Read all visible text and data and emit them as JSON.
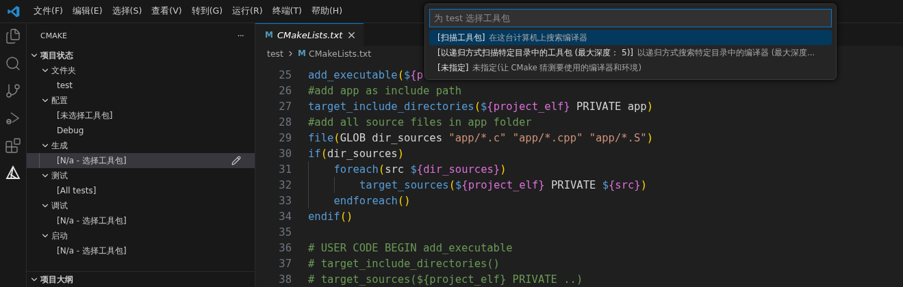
{
  "menu_bar": {
    "items": [
      "文件(F)",
      "编辑(E)",
      "选择(S)",
      "查看(V)",
      "转到(G)",
      "运行(R)",
      "终端(T)",
      "帮助(H)"
    ]
  },
  "activity_bar": [
    {
      "kind": "explorer",
      "selected": false
    },
    {
      "kind": "search",
      "selected": false
    },
    {
      "kind": "source_control",
      "selected": false
    },
    {
      "kind": "run_debug",
      "selected": false
    },
    {
      "kind": "extensions",
      "selected": false
    },
    {
      "kind": "cmake",
      "selected": true
    }
  ],
  "sidebar": {
    "title": "CMAKE",
    "more": "···",
    "sections": [
      {
        "label": "项目状态",
        "expanded": true,
        "children": [
          {
            "label": "文件夹",
            "expanded": true,
            "children": [
              {
                "label": "test",
                "selected": false
              }
            ]
          },
          {
            "label": "配置",
            "expanded": true,
            "children": [
              {
                "label": "[未选择工具包]",
                "selected": false
              },
              {
                "label": "Debug",
                "selected": false
              }
            ]
          },
          {
            "label": "生成",
            "expanded": true,
            "children": [
              {
                "label": "[N/a - 选择工具包]",
                "selected": true
              }
            ]
          },
          {
            "label": "测试",
            "expanded": true,
            "children": [
              {
                "label": "[All tests]",
                "selected": false
              }
            ]
          },
          {
            "label": "调试",
            "expanded": true,
            "children": [
              {
                "label": "[N/a - 选择工具包]",
                "selected": false
              }
            ]
          },
          {
            "label": "启动",
            "expanded": true,
            "children": [
              {
                "label": "[N/a - 选择工具包]",
                "selected": false
              }
            ]
          }
        ]
      },
      {
        "label": "项目大纲",
        "expanded": true
      }
    ]
  },
  "tabs": [
    {
      "label": "CMakeLists.txt",
      "icon": "M",
      "selected": true
    }
  ],
  "breadcrumb": [
    {
      "label": "test"
    },
    {
      "label": "CMakeLists.txt",
      "icon": "M"
    }
  ],
  "code": [
    {
      "number": "25",
      "tokens": [
        {
          "kind": "fn",
          "text": "add_executable"
        },
        {
          "kind": "paren",
          "text": "("
        },
        {
          "kind": "dollar",
          "text": "$"
        },
        {
          "kind": "var",
          "text": "{p"
        }
      ]
    },
    {
      "number": "26",
      "tokens": [
        {
          "kind": "comment",
          "text": "#add app as include path"
        }
      ]
    },
    {
      "number": "27",
      "tokens": [
        {
          "kind": "fn",
          "text": "target_include_directories"
        },
        {
          "kind": "paren",
          "text": "("
        },
        {
          "kind": "dollar",
          "text": "$"
        },
        {
          "kind": "var",
          "text": "{project_elf}"
        },
        {
          "kind": "plain",
          "text": " PRIVATE app"
        },
        {
          "kind": "paren",
          "text": ")"
        }
      ]
    },
    {
      "number": "28",
      "tokens": [
        {
          "kind": "comment",
          "text": "#add all source files in app folder"
        }
      ]
    },
    {
      "number": "29",
      "tokens": [
        {
          "kind": "fn",
          "text": "file"
        },
        {
          "kind": "paren",
          "text": "("
        },
        {
          "kind": "plain",
          "text": "GLOB dir_sources "
        },
        {
          "kind": "string",
          "text": "\"app/*.c\" "
        },
        {
          "kind": "string",
          "text": "\"app/*.cpp\" "
        },
        {
          "kind": "string",
          "text": "\"app/*.S\""
        },
        {
          "kind": "paren",
          "text": ")"
        }
      ]
    },
    {
      "number": "30",
      "tokens": [
        {
          "kind": "fn",
          "text": "if"
        },
        {
          "kind": "paren",
          "text": "("
        },
        {
          "kind": "plain",
          "text": "dir_sources"
        },
        {
          "kind": "paren",
          "text": ")"
        }
      ],
      "children": [
        {
          "number": "31",
          "tokens": [
            {
              "kind": "fn",
              "text": "foreach"
            },
            {
              "kind": "paren",
              "text": "("
            },
            {
              "kind": "plain",
              "text": "src "
            },
            {
              "kind": "dollar",
              "text": "$"
            },
            {
              "kind": "var",
              "text": "{dir_sources}"
            },
            {
              "kind": "paren",
              "text": ")"
            }
          ],
          "children": [
            {
              "number": "32",
              "tokens": [
                {
                  "kind": "fn",
                  "text": "target_sources"
                },
                {
                  "kind": "paren",
                  "text": "("
                },
                {
                  "kind": "dollar",
                  "text": "$"
                },
                {
                  "kind": "var",
                  "text": "{project_elf}"
                },
                {
                  "kind": "plain",
                  "text": " PRIVATE "
                },
                {
                  "kind": "dollar",
                  "text": "$"
                },
                {
                  "kind": "var",
                  "text": "{src}"
                },
                {
                  "kind": "paren",
                  "text": ")"
                }
              ]
            }
          ]
        },
        {
          "number": "33",
          "tokens": [
            {
              "kind": "fn",
              "text": "endforeach"
            },
            {
              "kind": "paren",
              "text": "()"
            }
          ]
        }
      ]
    },
    {
      "number": "34",
      "tokens": [
        {
          "kind": "fn",
          "text": "endif"
        },
        {
          "kind": "paren",
          "text": "()"
        }
      ]
    },
    {
      "number": "35"
    },
    {
      "number": "36",
      "tokens": [
        {
          "kind": "comment",
          "text": "# USER CODE BEGIN add_executable"
        }
      ]
    },
    {
      "number": "37",
      "tokens": [
        {
          "kind": "comment",
          "text": "# target_include_directories()"
        }
      ]
    },
    {
      "number": "38",
      "tokens": [
        {
          "kind": "comment",
          "text": "# target_sources(${project_elf} PRIVATE ..)"
        }
      ]
    }
  ],
  "quick_pick": {
    "placeholder": "为 test 选择工具包",
    "items": [
      {
        "label": "[扫描工具包]",
        "description": "在这台计算机上搜索编译器",
        "selected": true
      },
      {
        "label": "[以递归方式扫描特定目录中的工具包 (最大深度： 5)]",
        "description": "以递归方式搜索特定目录中的编译器 (最大深度...",
        "selected": false
      },
      {
        "label": "[未指定]",
        "description": "未指定(让 CMake 猜测要使用的编译器和环境)",
        "selected": false
      }
    ]
  }
}
